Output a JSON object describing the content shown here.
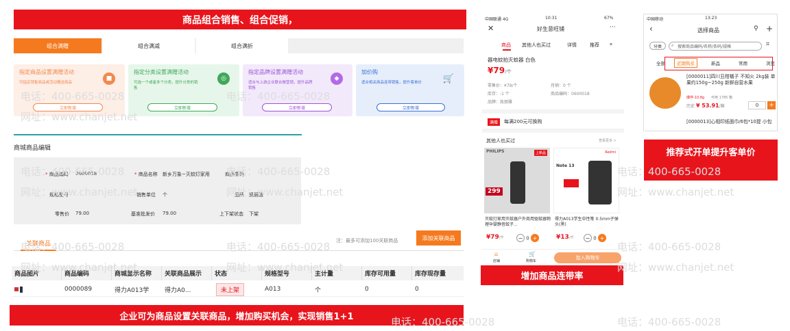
{
  "left": {
    "banner": "商品组合销售、组合促销，",
    "tabs": [
      "组合满赠",
      "组合满减",
      "组合满折"
    ],
    "cards": [
      {
        "title": "指定商品设置满赠活动",
        "desc": "可指定销售商品或活动赠送商品",
        "button": "立即新增",
        "icon": "gift-icon"
      },
      {
        "title": "指定分类设置满赠活动",
        "desc": "可选一个或者多个分类，提升分类的销售",
        "button": "立即新增",
        "icon": "target-icon"
      },
      {
        "title": "指定品牌设置满赠活动",
        "desc": "适合与上游企业联合做营销，提升品牌销售",
        "button": "立即新增",
        "icon": "diamond-icon"
      },
      {
        "title": "加价购",
        "desc": "适合相关商品连带销售，提升客单价",
        "button": "立即新增",
        "icon": "cart-icon"
      }
    ],
    "section_title": "商城商品编辑",
    "form": {
      "code_label": "商品编码",
      "code_value": "0600018",
      "name_label": "商品名称",
      "name_value": "新乡万象~灭蚊灯家用",
      "barcode_label": "商品条码",
      "spec_label": "规格型号",
      "unit_label": "销售单位",
      "unit_value": "个",
      "brand_label": "品牌",
      "brand_value": "凯丽雅",
      "retail_label": "零售价",
      "retail_value": "79.00",
      "wholesale_label": "基准批发价",
      "wholesale_value": "79.00",
      "shelf_label": "上下架状态",
      "shelf_value": "下架"
    },
    "related_tab": "关联商品",
    "note": "注：最多可添加100关联商品",
    "add_button": "添加关联商品",
    "table": {
      "headers": [
        "商品图片",
        "商品编码",
        "商城显示名称",
        "关联商品展示",
        "状态",
        "规格型号",
        "主计量",
        "库存可用量",
        "库存现存量"
      ],
      "rows": [
        [
          "",
          "0000089",
          "得力A013学",
          "得力A0...",
          "未上架",
          "A013",
          "个",
          "0",
          "0"
        ]
      ]
    },
    "footer": "企业可为商品设置关联商品，增加购买机会，实现销售1+1"
  },
  "phone1": {
    "status_left": "中国联通 4G",
    "status_time": "10:31",
    "status_right": "67%",
    "title": "好生意旺铺",
    "tabs": [
      "商品",
      "其他人也买过",
      "详情",
      "推荐"
    ],
    "product_name": "器电蚊拍灭蚊器 白色",
    "price": "¥79",
    "price_unit": "/个",
    "retail": "零售价：¥79/个",
    "monthly": "月销：0 个",
    "stock": "库存：-1 个",
    "code": "商品编码：0600018",
    "brand": "品牌：凯丽雅",
    "promo_tag": "满赠",
    "promo_text": "每满200元可换购",
    "others_title": "其他人也买过",
    "others_more": "查看更多 >",
    "items": [
      {
        "name": "灭蚊灯家用灭蚊器户外商用驱蚊器物理孕婴静音蚊子...",
        "price": "¥79",
        "unit": "/个",
        "qty": "0",
        "tag": "上新品",
        "logo": "PHILIPS",
        "img_price": "299"
      },
      {
        "name": "得力A013学生中性笔 0.5mm子弹头(黑)",
        "price": "¥13",
        "unit": "/个",
        "qty": "0",
        "logo": "Redmi",
        "model": "Note 13"
      }
    ],
    "nav_home": "店铺",
    "nav_cart": "购物车",
    "add_cart": "加入购物车",
    "caption": "增加商品连带率"
  },
  "phone2": {
    "status_left": "中国移动",
    "status_time": "13:23",
    "title": "选择商品",
    "category": "分类",
    "search_placeholder": "搜索商品编码/名称/条码/规格",
    "tabs": [
      "全部",
      "近期购买",
      "新品",
      "常用",
      "浏览"
    ],
    "item1_name": "[0000011]四川丑柑橘子 不知火 2kg装 单果约150g~250g 新鲜自营水果",
    "item1_tag": "爆伴-10.8g",
    "item1_stock": "可用 1785 箱",
    "item1_history": "历史",
    "item1_price": "¥ 53.91",
    "item1_unit": "/箱",
    "item1_qty": "0",
    "item2_name": "[0000013]心相印纸面巾/6包*10提 小包",
    "caption": "推荐式开单提升客单价"
  },
  "watermark": {
    "phone": "电话：400-665-0028",
    "site": "网址：www.chanjet.net"
  },
  "colors": {
    "red": "#e8141c",
    "orange": "#f57a1f"
  }
}
